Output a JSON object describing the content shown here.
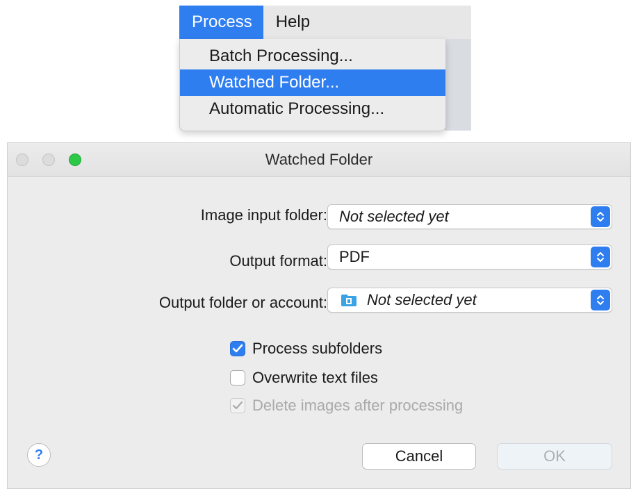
{
  "menu": {
    "bar": [
      {
        "label": "Process",
        "active": true
      },
      {
        "label": "Help",
        "active": false
      }
    ],
    "dropdown": [
      {
        "label": "Batch Processing...",
        "selected": false
      },
      {
        "label": "Watched Folder...",
        "selected": true
      },
      {
        "label": "Automatic Processing...",
        "selected": false
      }
    ]
  },
  "dialog": {
    "title": "Watched Folder",
    "fields": {
      "input_folder": {
        "label": "Image input folder:",
        "value": "Not selected yet"
      },
      "output_format": {
        "label": "Output format:",
        "value": "PDF"
      },
      "output_folder": {
        "label": "Output folder or account:",
        "value": "Not selected yet",
        "icon": "folder-icon"
      }
    },
    "options": {
      "process_subfolders": {
        "label": "Process subfolders",
        "checked": true,
        "enabled": true
      },
      "overwrite_text": {
        "label": "Overwrite text files",
        "checked": false,
        "enabled": true
      },
      "delete_images": {
        "label": "Delete images after processing",
        "checked": true,
        "enabled": false
      }
    },
    "buttons": {
      "help": "?",
      "cancel": "Cancel",
      "ok": "OK"
    }
  },
  "colors": {
    "accent": "#2f7ef0",
    "window_bg": "#ececec",
    "maximize_green": "#2ec848",
    "disabled_text": "#a9a9a9"
  }
}
